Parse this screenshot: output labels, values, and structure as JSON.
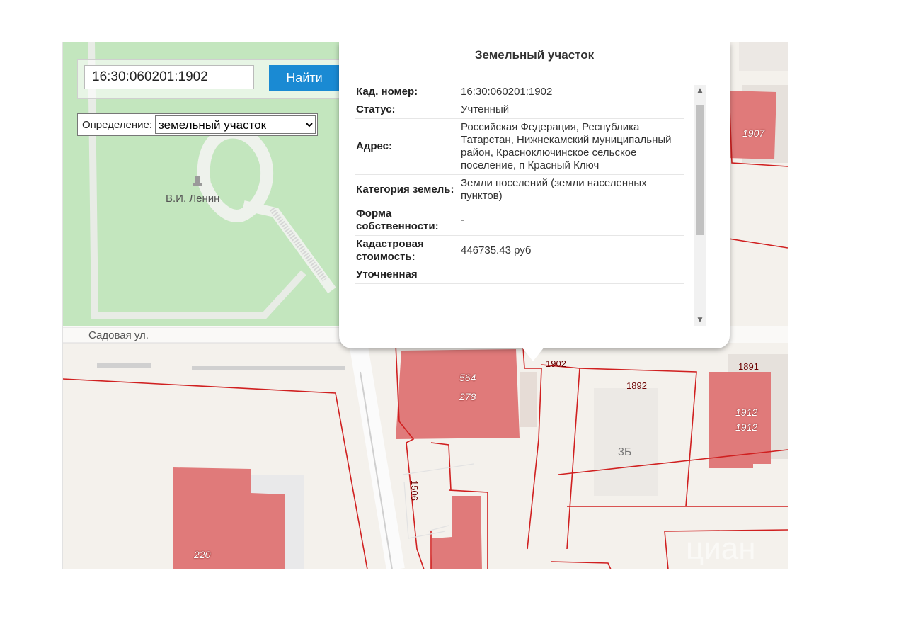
{
  "search": {
    "value": "16:30:060201:1902",
    "button_label": "Найти"
  },
  "definition": {
    "label": "Определение:",
    "selected": "земельный участок"
  },
  "map_labels": {
    "monument": "В.И. Ленин",
    "street": "Садовая ул.",
    "b564": "564",
    "b278": "278",
    "p1902": "1902",
    "p1892": "1892",
    "house3b": "3Б",
    "p1891": "1891",
    "b1912a": "1912",
    "b1912b": "1912",
    "b1907": "1907",
    "p1506": "1506",
    "b220": "220",
    "watermark": "циан"
  },
  "popup": {
    "title": "Земельный участок",
    "rows": [
      {
        "key": "Кад. номер:",
        "value": "16:30:060201:1902"
      },
      {
        "key": "Статус:",
        "value": "Учтенный"
      },
      {
        "key": "Адрес:",
        "value": "Российская Федерация, Республика Татарстан, Нижнекамский муниципальный район, Красноключинское сельское поселение, п Красный Ключ"
      },
      {
        "key": "Категория земель:",
        "value": "Земли поселений (земли населенных пунктов)"
      },
      {
        "key": "Форма собственности:",
        "value": "-"
      },
      {
        "key": "Кадастровая стоимость:",
        "value": "446735.43 руб"
      },
      {
        "key": "Уточненная",
        "value": ""
      }
    ]
  },
  "colors": {
    "park": "#c3e6be",
    "building": "#e07a7a",
    "boundary": "#d02020",
    "accent": "#1a8ad3"
  }
}
